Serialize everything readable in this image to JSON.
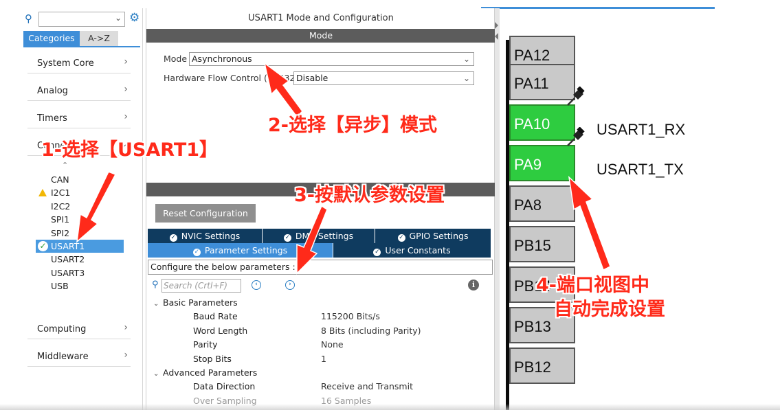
{
  "sidebar": {
    "tabs": {
      "categories": "Categories",
      "atoz": "A->Z"
    },
    "categories": [
      "System Core",
      "Analog",
      "Timers",
      "Connectivity",
      "Computing",
      "Middleware"
    ],
    "connectivity_items": [
      "CAN",
      "I2C1",
      "I2C2",
      "SPI1",
      "SPI2",
      "USART1",
      "USART2",
      "USART3",
      "USB"
    ],
    "selected": "USART1"
  },
  "config": {
    "title": "USART1 Mode and Configuration",
    "mode_header": "Mode",
    "mode_label": "Mode",
    "mode_value": "Asynchronous",
    "hwfc_label": "Hardware Flow Control (RS232)",
    "hwfc_value": "Disable",
    "reset_button": "Reset Configuration",
    "tabs": [
      "NVIC Settings",
      "DMA Settings",
      "GPIO Settings",
      "Parameter Settings",
      "User Constants"
    ],
    "active_tab": "Parameter Settings",
    "configure_text": "Configure the below parameters :",
    "search_placeholder": "Search (Crtl+F)",
    "basic_header": "Basic Parameters",
    "basic_params": [
      {
        "key": "Baud Rate",
        "value": "115200 Bits/s"
      },
      {
        "key": "Word Length",
        "value": "8 Bits (including Parity)"
      },
      {
        "key": "Parity",
        "value": "None"
      },
      {
        "key": "Stop Bits",
        "value": "1"
      }
    ],
    "advanced_header": "Advanced Parameters",
    "advanced_params": [
      {
        "key": "Data Direction",
        "value": "Receive and Transmit"
      },
      {
        "key": "Over Sampling",
        "value": "16 Samples"
      }
    ]
  },
  "pins": {
    "list": [
      "PA12",
      "PA11",
      "PA10",
      "PA9",
      "PA8",
      "PB15",
      "PB14",
      "PB13",
      "PB12"
    ],
    "active": [
      "PA10",
      "PA9"
    ],
    "labels": {
      "PA10": "USART1_RX",
      "PA9": "USART1_TX"
    }
  },
  "annotations": {
    "step1": "1-选择【USART1】",
    "step2": "2-选择【异步】模式",
    "step3": "3-按默认参数设置",
    "step4_line1": "4-端口视图中",
    "step4_line2": "自动完成设置"
  },
  "colors": {
    "accent": "#3e8ed8",
    "tab_dark": "#0f3b5f",
    "pin_active": "#2ecc40",
    "pin_idle": "#c9c9c9",
    "annotation": "#ff2a1a"
  }
}
